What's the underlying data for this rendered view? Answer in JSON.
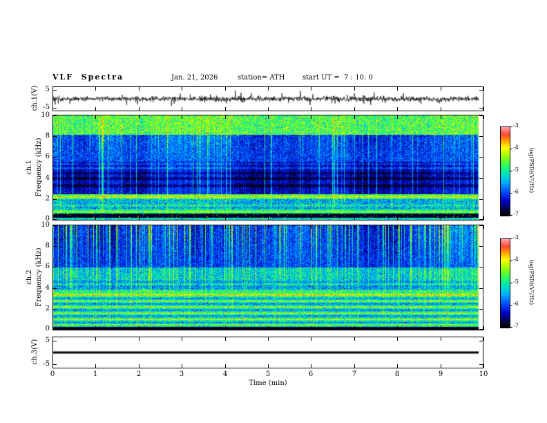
{
  "header": {
    "title": "VLF  Spectra",
    "date": "Jan. 21, 2026",
    "station": "station= ATH",
    "start_ut": "start UT =  7 : 10: 0"
  },
  "x_axis": {
    "label": "Time  (min)",
    "lim": [
      0,
      10
    ],
    "data_end": 9.9,
    "ticks": [
      "0",
      "1",
      "2",
      "3",
      "4",
      "5",
      "6",
      "7",
      "8",
      "9",
      "10"
    ]
  },
  "colorbar": {
    "label": "log(PSD)(V²/Hz)",
    "range": [
      -7,
      -3
    ],
    "ticks": [
      "-3",
      "-4",
      "-5",
      "-6",
      "-7"
    ],
    "colormap": [
      {
        "t": 0.0,
        "c": "#000000"
      },
      {
        "t": 0.06,
        "c": "#06063c"
      },
      {
        "t": 0.16,
        "c": "#0000c8"
      },
      {
        "t": 0.27,
        "c": "#0050ff"
      },
      {
        "t": 0.38,
        "c": "#00b4ff"
      },
      {
        "t": 0.48,
        "c": "#00e6b4"
      },
      {
        "t": 0.58,
        "c": "#3cff50"
      },
      {
        "t": 0.68,
        "c": "#a0ff00"
      },
      {
        "t": 0.77,
        "c": "#ffff00"
      },
      {
        "t": 0.85,
        "c": "#ffa000"
      },
      {
        "t": 0.92,
        "c": "#ff4632"
      },
      {
        "t": 1.0,
        "c": "#ffa0aa"
      }
    ]
  },
  "chart_data": [
    {
      "id": "ch1_wave",
      "type": "line",
      "ylabel": "ch.1(V)",
      "ylim": [
        -6.5,
        6.5
      ],
      "ytick_vals": [
        5,
        -5
      ],
      "yticks": [
        "5",
        "-5"
      ],
      "signal": {
        "n": 1500,
        "mean": 0,
        "sigma": 1.0,
        "spike_p": 0.03,
        "spike_amp": [
          1.5,
          3.8
        ]
      }
    },
    {
      "id": "ch1_spec",
      "type": "heatmap",
      "ylabel_channel": "ch.1",
      "ylabel_axis": "Frequency  (kHz)",
      "flim": [
        0,
        10
      ],
      "ytick_vals": [
        10,
        8,
        6,
        4,
        2,
        0
      ],
      "yticks": [
        "10",
        "8",
        "6",
        "4",
        "2",
        "0"
      ],
      "value_range": [
        -7,
        -3
      ],
      "streaks": {
        "spike_p": 0.1,
        "spike_amp": [
          0.6,
          1.8
        ],
        "jitter": 0.25
      },
      "bands": [
        {
          "f": [
            8.2,
            10.01
          ],
          "base": -4.65,
          "noise": 0.62,
          "streak": 0.35
        },
        {
          "f": [
            5.6,
            8.2
          ],
          "base": -5.95,
          "noise": 0.42,
          "streak": 0.95,
          "streak_grad": true
        },
        {
          "f": [
            2.45,
            5.6
          ],
          "base": -6.3,
          "noise": 0.32,
          "streak": 0.7
        },
        {
          "f": [
            1.95,
            2.45
          ],
          "base": -4.75,
          "noise": 0.5,
          "streak": 0.2,
          "speckle": {
            "p": 0.02,
            "v": -3.3
          }
        },
        {
          "f": [
            1.0,
            1.95
          ],
          "base": -5.45,
          "noise": 0.55,
          "streak": 0.3,
          "speckle": {
            "p": 0.006,
            "v": -3.5
          }
        },
        {
          "f": [
            0.55,
            1.0
          ],
          "base": -4.95,
          "noise": 0.45,
          "streak": 0.2
        },
        {
          "f": [
            0.18,
            0.55
          ],
          "base": -6.85,
          "noise": 0.2,
          "streak": 0.05,
          "speckle": {
            "p": 0.025,
            "v": -3.9
          }
        },
        {
          "f": [
            -0.01,
            0.18
          ],
          "base": -5.2,
          "noise": 0.45,
          "streak": 0.1,
          "speckle": {
            "p": 0.03,
            "v": -3.4
          }
        }
      ],
      "lines": [
        {
          "f": 4.95,
          "amp": 0.55,
          "w": 0.05
        },
        {
          "f": 5.35,
          "amp": 0.45,
          "w": 0.05
        },
        {
          "f": 3.25,
          "amp": -0.55,
          "w": 0.09
        },
        {
          "f": 3.95,
          "amp": -0.55,
          "w": 0.09
        },
        {
          "f": 4.45,
          "amp": -0.45,
          "w": 0.07
        },
        {
          "f": 2.2,
          "amp": 0.7,
          "w": 0.07
        },
        {
          "f": 1.35,
          "amp": 0.5,
          "w": 0.06
        },
        {
          "f": 0.75,
          "amp": 0.55,
          "w": 0.06
        }
      ]
    },
    {
      "id": "ch2_spec",
      "type": "heatmap",
      "ylabel_channel": "ch.2",
      "ylabel_axis": "Frequency  (kHz)",
      "flim": [
        0,
        10
      ],
      "ytick_vals": [
        10,
        8,
        6,
        4,
        2,
        0
      ],
      "yticks": [
        "10",
        "8",
        "6",
        "4",
        "2",
        "0"
      ],
      "value_range": [
        -7,
        -3
      ],
      "streaks": {
        "spike_p": 0.17,
        "spike_amp": [
          0.7,
          2.0
        ],
        "jitter": 0.3
      },
      "bands": [
        {
          "f": [
            6.0,
            10.01
          ],
          "base": -6.0,
          "noise": 0.4,
          "streak": 1.15,
          "streak_grad": true
        },
        {
          "f": [
            4.7,
            6.0
          ],
          "base": -5.25,
          "noise": 0.5,
          "streak": 0.5
        },
        {
          "f": [
            3.85,
            4.7
          ],
          "base": -5.55,
          "noise": 0.5,
          "streak": 0.35
        },
        {
          "f": [
            2.95,
            3.85
          ],
          "base": -4.9,
          "noise": 0.5,
          "streak": 0.2,
          "speckle": {
            "p": 0.012,
            "v": -3.3
          }
        },
        {
          "f": [
            0.2,
            2.95
          ],
          "base": -5.15,
          "noise": 0.45,
          "streak": 0.15,
          "speckle": {
            "p": 0.015,
            "v": -3.35
          }
        },
        {
          "f": [
            -0.01,
            0.2
          ],
          "base": -6.9,
          "noise": 0.12,
          "streak": 0.0
        }
      ],
      "lines": [
        {
          "f": 4.35,
          "amp": 0.65,
          "w": 0.05
        },
        {
          "f": 3.35,
          "amp": 1.15,
          "w": 0.06
        },
        {
          "f": 3.0,
          "amp": -0.75,
          "w": 0.05
        },
        {
          "f": 2.72,
          "amp": 0.85,
          "w": 0.05
        },
        {
          "f": 2.45,
          "amp": -0.65,
          "w": 0.05
        },
        {
          "f": 2.15,
          "amp": 0.95,
          "w": 0.05
        },
        {
          "f": 1.85,
          "amp": -0.65,
          "w": 0.05
        },
        {
          "f": 1.55,
          "amp": 0.9,
          "w": 0.05
        },
        {
          "f": 1.28,
          "amp": -0.6,
          "w": 0.05
        },
        {
          "f": 0.95,
          "amp": 1.0,
          "w": 0.05
        },
        {
          "f": 0.65,
          "amp": -0.55,
          "w": 0.05
        },
        {
          "f": 0.45,
          "amp": 0.75,
          "w": 0.04
        }
      ]
    },
    {
      "id": "ch3_wave",
      "type": "line",
      "ylabel": "ch.3(V)",
      "ylim": [
        -6.5,
        6.5
      ],
      "ytick_vals": [
        5,
        -5
      ],
      "yticks": [
        "5",
        "-5"
      ],
      "signal": {
        "constant": 0,
        "linewidth": 3
      }
    }
  ]
}
